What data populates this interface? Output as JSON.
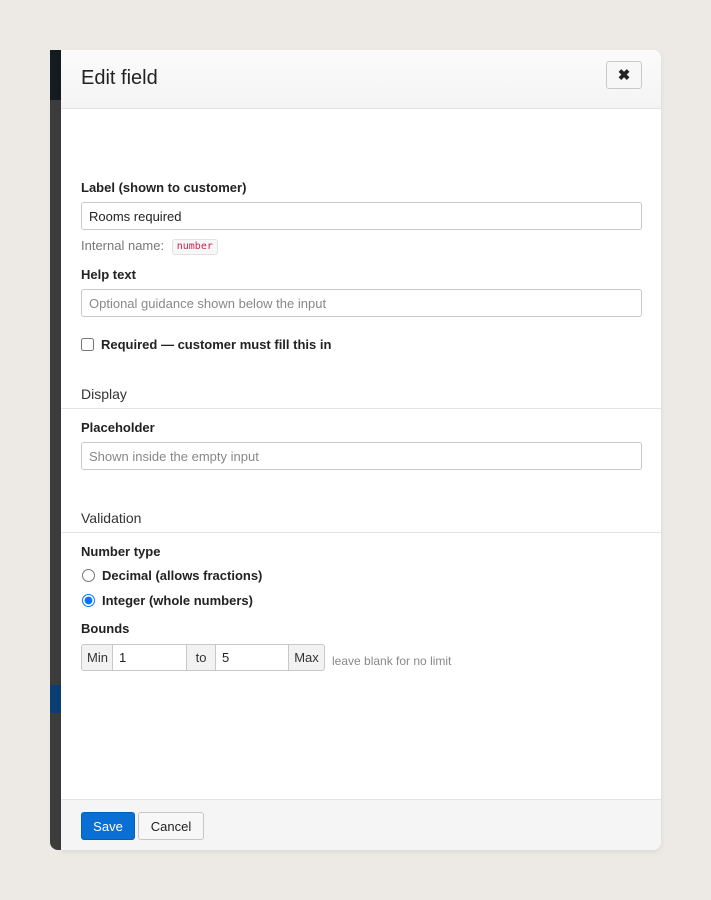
{
  "modal": {
    "title": "Edit field",
    "close_icon": "close-icon",
    "close_glyph": "✖"
  },
  "label_field": {
    "label": "Label (shown to customer)",
    "value": "Rooms required"
  },
  "internal_name": {
    "prefix": "Internal name:",
    "value": "number"
  },
  "help_text": {
    "label": "Help text",
    "placeholder": "Optional guidance shown below the input",
    "value": ""
  },
  "required": {
    "label": "Required — customer must fill this in",
    "checked": false
  },
  "display_section": {
    "title": "Display",
    "placeholder_label": "Placeholder",
    "placeholder_input_placeholder": "Shown inside the empty input",
    "placeholder_value": ""
  },
  "validation_section": {
    "title": "Validation",
    "number_type_label": "Number type",
    "options": [
      {
        "label": "Decimal (allows fractions)",
        "selected": false
      },
      {
        "label": "Integer (whole numbers)",
        "selected": true
      }
    ],
    "bounds_label": "Bounds",
    "min_label": "Min",
    "min_value": "1",
    "to_label": "to",
    "max_value": "5",
    "max_label": "Max",
    "hint": "leave blank for no limit"
  },
  "footer": {
    "save_label": "Save",
    "cancel_label": "Cancel"
  },
  "colors": {
    "primary": "#0a6fd4",
    "code_text": "#c7254e",
    "page_bg": "#edeae5"
  }
}
